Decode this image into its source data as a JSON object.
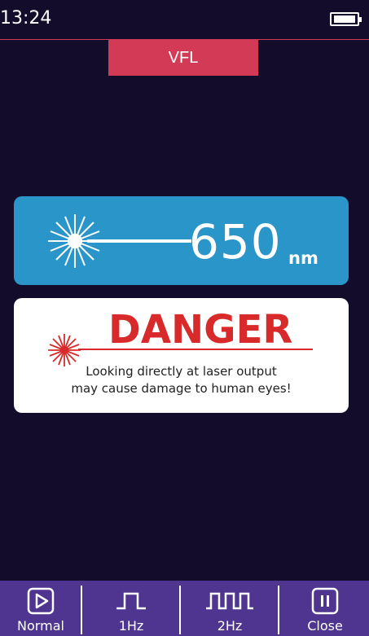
{
  "status": {
    "time": "13:24",
    "battery_icon": "battery-icon"
  },
  "mode": {
    "title": "VFL"
  },
  "wavelength": {
    "value": "650",
    "unit": "nm",
    "icon": "laser-burst-icon"
  },
  "warning": {
    "title": "DANGER",
    "line1": "Looking directly at laser output",
    "line2": "may cause damage to human eyes!",
    "icon": "laser-burst-icon",
    "color": "#d82a2a"
  },
  "toolbar": {
    "normal": "Normal",
    "hz1": "1Hz",
    "hz2": "2Hz",
    "close": "Close"
  },
  "colors": {
    "background": "#130d2b",
    "accent": "#d23a55",
    "wave_card": "#2a95c9",
    "toolbar": "#4f3590"
  }
}
